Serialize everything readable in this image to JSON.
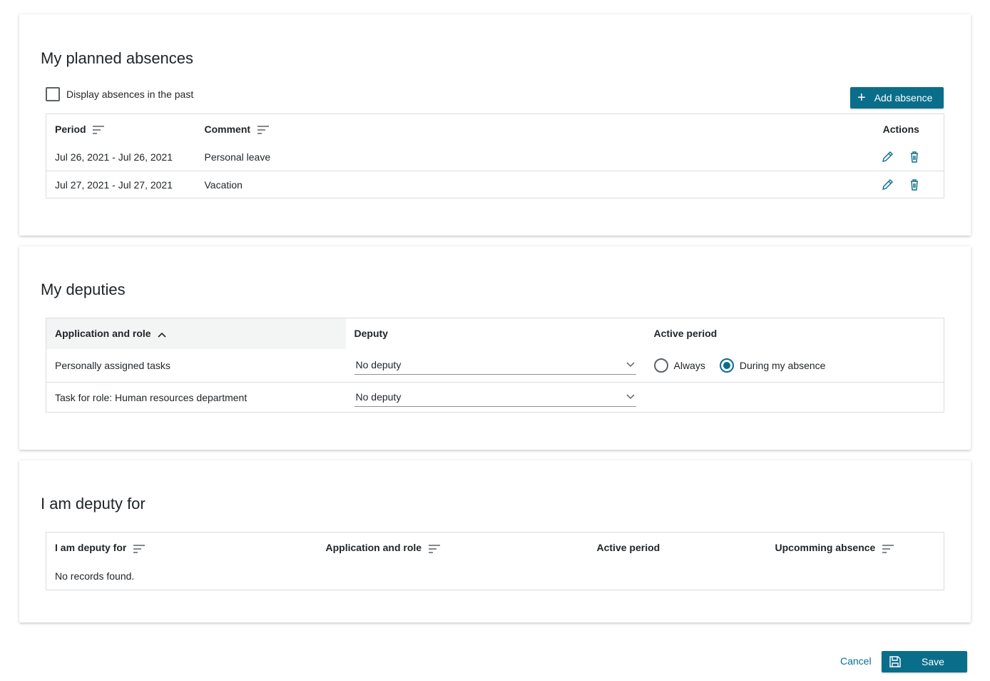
{
  "colors": {
    "accent": "#0a6e8a",
    "border": "#d9dcde",
    "text": "#1f2428"
  },
  "planned": {
    "title": "My planned absences",
    "show_past_label": "Display absences in the past",
    "add_label": "Add absence",
    "headers": {
      "period": "Period",
      "comment": "Comment",
      "actions": "Actions"
    },
    "rows": [
      {
        "period": "Jul 26, 2021 - Jul 26, 2021",
        "comment": "Personal leave"
      },
      {
        "period": "Jul 27, 2021 - Jul 27, 2021",
        "comment": "Vacation"
      }
    ]
  },
  "deputies": {
    "title": "My deputies",
    "headers": {
      "app_role": "Application and role",
      "deputy": "Deputy",
      "active_period": "Active period"
    },
    "rows": [
      {
        "app_role": "Personally assigned tasks",
        "deputy": "No deputy"
      },
      {
        "app_role": "Task for role: Human resources department",
        "deputy": "No deputy"
      }
    ],
    "radio": {
      "always": "Always",
      "during": "During my absence",
      "selected": "during"
    }
  },
  "deputy_for": {
    "title": "I am deputy for",
    "headers": {
      "deputy_for": "I am deputy for",
      "app_role": "Application and role",
      "active_period": "Active period",
      "upcoming": "Upcomming absence"
    },
    "empty": "No records found."
  },
  "footer": {
    "cancel": "Cancel",
    "save": "Save"
  }
}
